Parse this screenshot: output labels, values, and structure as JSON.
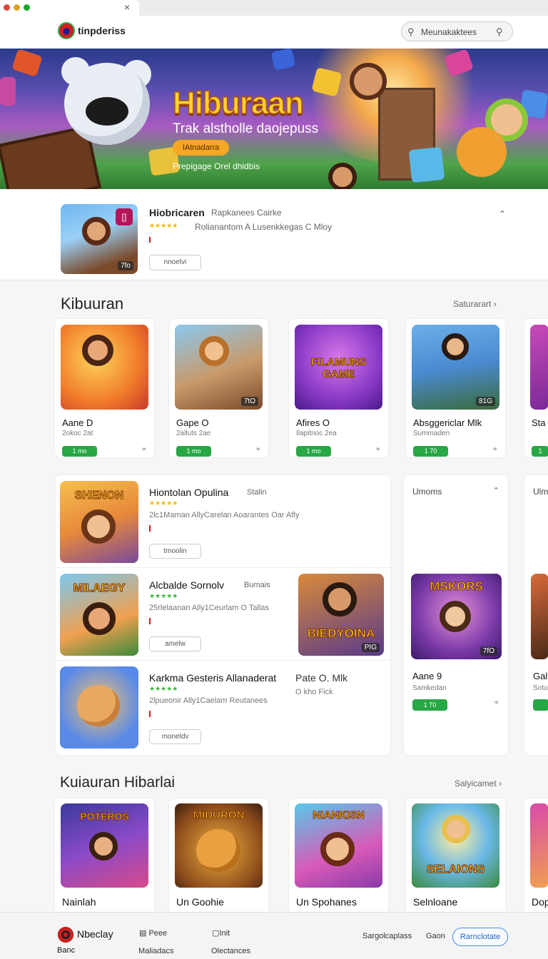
{
  "browser": {
    "close_glyph": "×",
    "dots": [
      "#e0443e",
      "#dea123",
      "#1aab29"
    ]
  },
  "header": {
    "logo_text": "tinpderiss",
    "search_placeholder": "Meunakaktees",
    "search_icon": "search-icon"
  },
  "hero": {
    "title": "Hiburaan",
    "subtitle": "Trak alstholle daojepuss",
    "button": "IAtnadarra",
    "note": "Prepigage Orel dhidbis"
  },
  "featured": {
    "title": "Hiobricaren",
    "category": "Rapkanees  Cairke",
    "stars": "★★★★★",
    "meta": "Rolianantom  A Lusenkkegas    C Mloy",
    "button": "nnoelvi",
    "badge": "[]",
    "thumb_tag": "7fo"
  },
  "section1": {
    "title": "Kibuuran",
    "see_all": "Saturarart",
    "cards": [
      {
        "name": "Aane D",
        "sub": "2okoc 2at",
        "pill": "1 mo",
        "tag": ""
      },
      {
        "name": "Gape O",
        "sub": "2alluts 2ae",
        "pill": "1 mo",
        "tag": "7tO"
      },
      {
        "name": "Afires O",
        "sub": "Ilapitnoc 2ea",
        "pill": "1 mo",
        "tag": "",
        "art_text": "FILAMUNS GAME"
      },
      {
        "name": "Absggericlar Mlk",
        "sub": "Summaden",
        "pill": "1 70",
        "tag": "81G"
      },
      {
        "name": "Sta",
        "sub": "",
        "pill": "1"
      }
    ]
  },
  "list": {
    "rows": [
      {
        "title": "Hiontolan Opulina",
        "cat": "Stalin",
        "stars": "★★★★★",
        "meta": "2lc1Maman  AllyCarelan  Aoarantes      Oar Afly",
        "button": "tmoolin",
        "art_text": "SHENON"
      },
      {
        "title": "Alcbalde Sornolv",
        "cat": "Bumais",
        "stars": "★★★★★",
        "meta": "25rlelaanan  Ally1Ceurlam   O Tallas",
        "button": "amelw",
        "art_text": "MILAEGY",
        "second_art_text": "BIEDYOINA",
        "second_tag": "PIG"
      },
      {
        "title": "Karkma Gesteris Allanaderat",
        "cat": "Pate O. Mlk",
        "stars": "★★★★★",
        "meta": "2lpueonir  Ally1Caelam   Reutanees",
        "meta2": "O kho Fick",
        "button": "moneldv"
      }
    ]
  },
  "side_panel": {
    "header": "Umoms",
    "name": "Aane 9",
    "sub": "Samkedan",
    "pill": "1 70",
    "art_text": "MSKORS",
    "tag": "7fO"
  },
  "side_panel_2": {
    "header": "Ulm",
    "name": "Gall",
    "sub": "Sotu"
  },
  "section2": {
    "title": "Kuiauran Hibarlai",
    "see_all": "Salyicamet",
    "cards": [
      {
        "name": "Nainlah",
        "art_text": "POTEROS"
      },
      {
        "name": "Un Goohie",
        "art_text": "MIDURON"
      },
      {
        "name": "Un Spohanes",
        "art_text": "NIANKISN"
      },
      {
        "name": "Selnloane",
        "art_text": "SELAIONS"
      },
      {
        "name": "Dop"
      }
    ]
  },
  "bottom_bar": {
    "brand": "Nbeclay",
    "brand_sub": "Banc",
    "item1_top": "Peee",
    "item1_bottom": "Maliadacs",
    "item2_top": "Init",
    "item2_bottom": "Olectances",
    "link1": "Sargolcaplass",
    "link2": "Gaon",
    "cta": "Rarnclotate"
  },
  "colors": {
    "accent": "#28a745",
    "brand_red": "#d11e1e",
    "hero_title": "#ffd22e",
    "cta_blue": "#2a6cc8"
  }
}
